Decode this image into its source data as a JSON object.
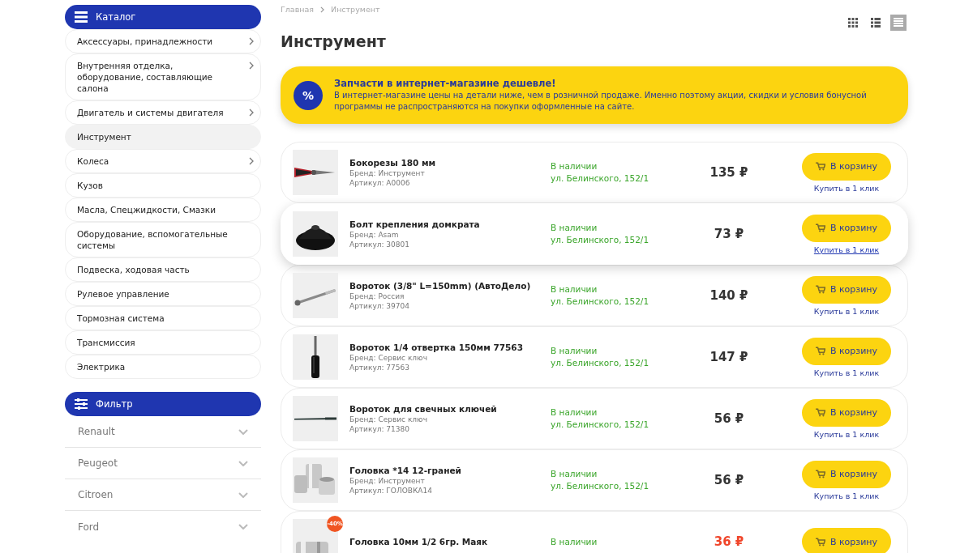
{
  "catalog": {
    "title": "Каталог",
    "items": [
      {
        "label": "Аксессуары, принадлежности",
        "selected": false,
        "has_children": true
      },
      {
        "label": "Внутренняя отделка, оборудование, составляющие салона",
        "selected": false,
        "has_children": true
      },
      {
        "label": "Двигатель и системы двигателя",
        "selected": false,
        "has_children": true
      },
      {
        "label": "Инструмент",
        "selected": true,
        "has_children": false
      },
      {
        "label": "Колеса",
        "selected": false,
        "has_children": true
      },
      {
        "label": "Кузов",
        "selected": false,
        "has_children": false
      },
      {
        "label": "Масла, Спецжидкости, Смазки",
        "selected": false,
        "has_children": false
      },
      {
        "label": "Оборудование, вспомогательные системы",
        "selected": false,
        "has_children": false
      },
      {
        "label": "Подвеска, ходовая часть",
        "selected": false,
        "has_children": false
      },
      {
        "label": "Рулевое управление",
        "selected": false,
        "has_children": false
      },
      {
        "label": "Тормозная система",
        "selected": false,
        "has_children": false
      },
      {
        "label": "Трансмиссия",
        "selected": false,
        "has_children": false
      },
      {
        "label": "Электрика",
        "selected": false,
        "has_children": false
      }
    ]
  },
  "filter": {
    "title": "Фильтр",
    "items": [
      {
        "label": "Renault",
        "expanded": false
      },
      {
        "label": "Peugeot",
        "expanded": false
      },
      {
        "label": "Citroen",
        "expanded": false
      },
      {
        "label": "Ford",
        "expanded": false
      }
    ]
  },
  "breadcrumbs": [
    "Главная",
    "Инструмент"
  ],
  "page_title": "Инструмент",
  "views": [
    {
      "kind": "grid",
      "selected": false
    },
    {
      "kind": "list",
      "selected": false
    },
    {
      "kind": "table",
      "selected": true
    }
  ],
  "promo": {
    "icon": "%",
    "title": "Запчасти в интернет-магазине дешевле!",
    "text": "В интернет-магазине цены на детали ниже, чем в розничной продаже. Именно поэтому акции, скидки и условия бонусной программы не распространяются на покупки оформленные на сайте."
  },
  "products": [
    {
      "name": "Бокорезы 180 мм",
      "brand": "Бренд: Инструмент",
      "sku": "Артикул: A0006",
      "availability": "В наличии",
      "address": "ул. Белинского, 152/1",
      "price": "135 ₽",
      "sale": false,
      "hovered": false,
      "button": "В корзину",
      "quick_buy": "Купить в 1 клик"
    },
    {
      "name": "Болт крепления домкрата",
      "brand": "Бренд: Asam",
      "sku": "Артикул: 30801",
      "availability": "В наличии",
      "address": "ул. Белинского, 152/1",
      "price": "73 ₽",
      "sale": false,
      "hovered": true,
      "button": "В корзину",
      "quick_buy": "Купить в 1 клик"
    },
    {
      "name": "Вороток (3/8\" L=150mm) (АвтоДело)",
      "brand": "Бренд: Россия",
      "sku": "Артикул: 39704",
      "availability": "В наличии",
      "address": "ул. Белинского, 152/1",
      "price": "140 ₽",
      "sale": false,
      "hovered": false,
      "button": "В корзину",
      "quick_buy": "Купить в 1 клик"
    },
    {
      "name": "Вороток 1/4 отвертка 150мм 77563",
      "brand": "Бренд: Сервис ключ",
      "sku": "Артикул: 77563",
      "availability": "В наличии",
      "address": "ул. Белинского, 152/1",
      "price": "147 ₽",
      "sale": false,
      "hovered": false,
      "button": "В корзину",
      "quick_buy": "Купить в 1 клик"
    },
    {
      "name": "Вороток для свечных ключей",
      "brand": "Бренд: Сервис ключ",
      "sku": "Артикул: 71380",
      "availability": "В наличии",
      "address": "ул. Белинского, 152/1",
      "price": "56 ₽",
      "sale": false,
      "hovered": false,
      "button": "В корзину",
      "quick_buy": "Купить в 1 клик"
    },
    {
      "name": "Головка *14 12-граней",
      "brand": "Бренд: Инструмент",
      "sku": "Артикул: ГОЛОВКА14",
      "availability": "В наличии",
      "address": "ул. Белинского, 152/1",
      "price": "56 ₽",
      "sale": false,
      "hovered": false,
      "button": "В корзину",
      "quick_buy": "Купить в 1 клик"
    },
    {
      "name": "Головка 10мм 1/2 6гр. Маяк",
      "badge": "-40%",
      "availability": "В наличии",
      "price": "36 ₽",
      "sale": true,
      "hovered": false,
      "button": "В корзину"
    }
  ]
}
